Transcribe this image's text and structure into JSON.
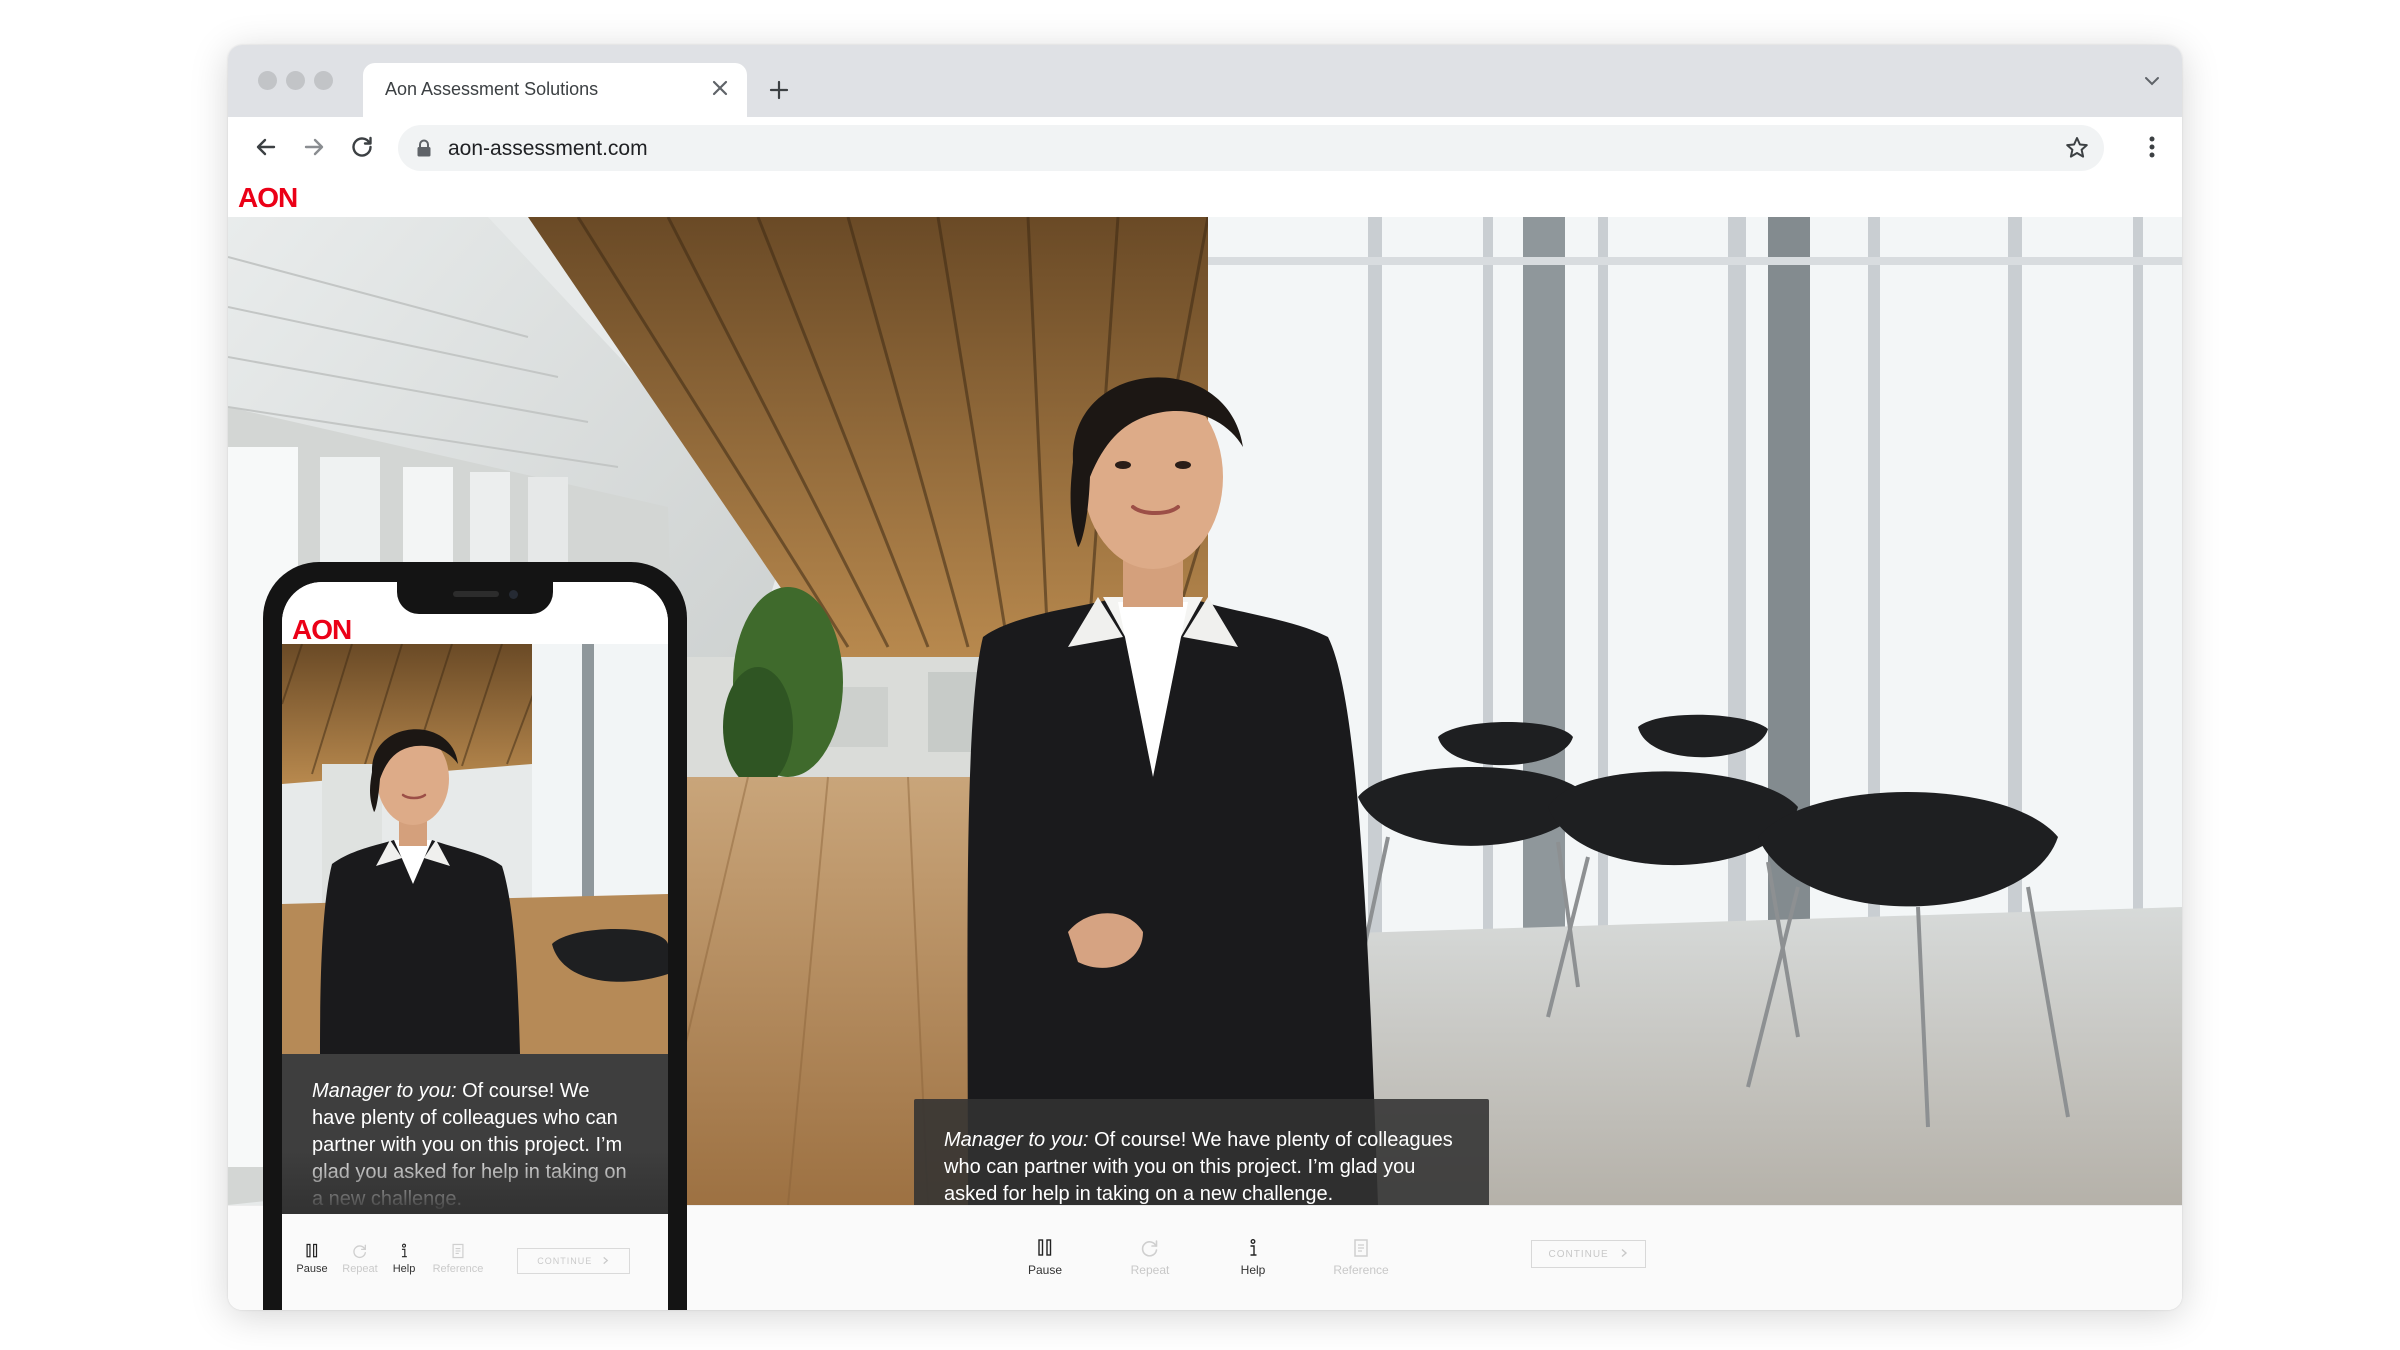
{
  "browser": {
    "tab_title": "Aon Assessment Solutions",
    "url": "aon-assessment.com",
    "icons": {
      "back": "arrow-left-icon",
      "forward": "arrow-right-icon",
      "reload": "reload-icon",
      "lock": "lock-icon",
      "bookmark": "star-icon",
      "menu": "kebab-menu-icon",
      "close_tab": "close-icon",
      "new_tab": "plus-icon",
      "tab_list": "chevron-down-icon"
    }
  },
  "app": {
    "logo": "AON",
    "brand_color": "#eb0017"
  },
  "caption": {
    "speaker": "Manager to you:",
    "text": " Of course! We have plenty of colleagues who can partner with you on this project. I’m glad you asked for help in taking on a new challenge."
  },
  "controls": {
    "pause": {
      "label": "Pause",
      "icon": "pause-icon",
      "enabled": true
    },
    "repeat": {
      "label": "Repeat",
      "icon": "repeat-icon",
      "enabled": false
    },
    "help": {
      "label": "Help",
      "icon": "info-icon",
      "enabled": true
    },
    "reference": {
      "label": "Reference",
      "icon": "document-icon",
      "enabled": false
    },
    "continue": {
      "label": "CONTINUE",
      "icon": "chevron-right-icon",
      "enabled": false
    }
  }
}
